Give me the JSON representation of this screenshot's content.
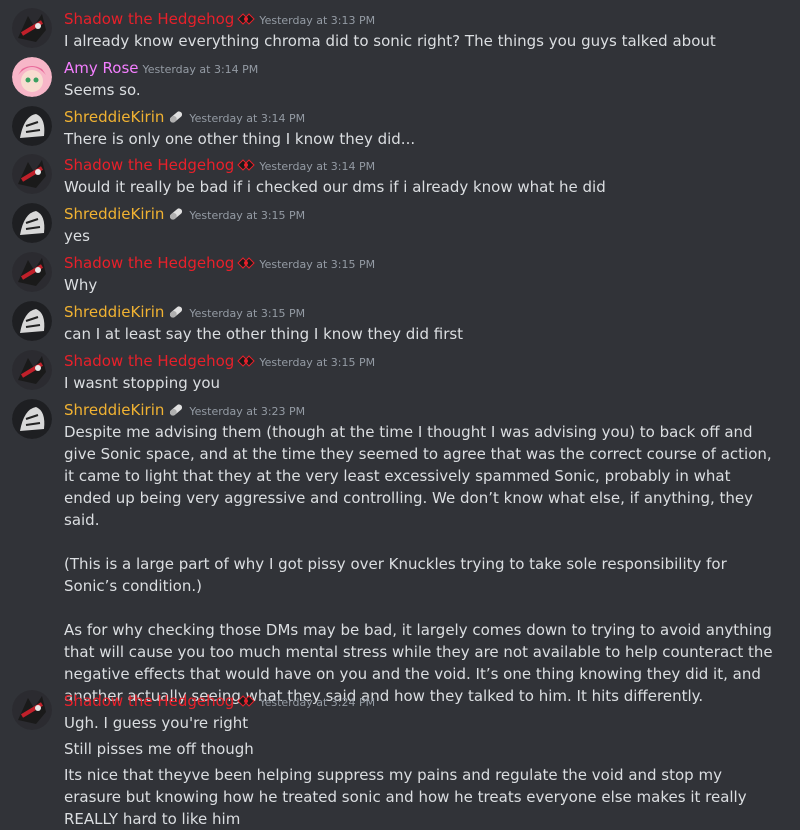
{
  "users": {
    "shadow": {
      "name": "Shadow the Hedgehog",
      "color": "#e8202a",
      "badge_icon": "shadow-emblem-icon"
    },
    "amy": {
      "name": "Amy Rose",
      "color": "#f47fff"
    },
    "kirin": {
      "name": "ShreddieKirin",
      "color": "#f0b232",
      "badge_icon": "pill-icon"
    }
  },
  "messages": [
    {
      "author": "Shadow the Hedgehog",
      "timestamp": "Yesterday at 3:13 PM",
      "text": "I already know everything chroma did to sonic right? The things you guys talked about"
    },
    {
      "author": "Amy Rose",
      "timestamp": "Yesterday at 3:14 PM",
      "text": "Seems so."
    },
    {
      "author": "ShreddieKirin",
      "timestamp": "Yesterday at 3:14 PM",
      "text": "There is only one other thing I know they did..."
    },
    {
      "author": "Shadow the Hedgehog",
      "timestamp": "Yesterday at 3:14 PM",
      "text": "Would it really be bad if i checked our dms if i already know what he did"
    },
    {
      "author": "ShreddieKirin",
      "timestamp": "Yesterday at 3:15 PM",
      "text": "yes"
    },
    {
      "author": "Shadow the Hedgehog",
      "timestamp": "Yesterday at 3:15 PM",
      "text": "Why"
    },
    {
      "author": "ShreddieKirin",
      "timestamp": "Yesterday at 3:15 PM",
      "text": "can I at least say the other thing I know they did first"
    },
    {
      "author": "Shadow the Hedgehog",
      "timestamp": "Yesterday at 3:15 PM",
      "text": "I wasnt stopping you"
    },
    {
      "author": "ShreddieKirin",
      "timestamp": "Yesterday at 3:23 PM",
      "p1": "Despite me advising them (though at the time I thought I was advising you) to back off and give Sonic space, and at the time they seemed to agree that was the correct course of action, it came to light that they at the very least excessively spammed Sonic, probably in what ended up being very aggressive and controlling. We don’t know what else, if anything, they said.",
      "p2": "(This is a large part of why I got pissy over Knuckles trying to take sole responsibility for Sonic’s condition.)",
      "p3": "As for why checking those DMs may be bad, it largely comes down to trying to avoid anything that will cause you too much mental stress while they are not available to help counteract the negative effects that would have on you and the void. It’s one thing knowing they did it, and another actually seeing what they said and how they talked to him. It hits differently."
    },
    {
      "author": "Shadow the Hedgehog",
      "timestamp": "Yesterday at 3:24 PM",
      "l1": "Ugh. I guess you're right",
      "l2": "Still pisses me off though",
      "l3": "Its nice that theyve been helping suppress my pains and regulate the void and stop my erasure but knowing how he treated sonic and how he treats everyone else makes it really REALLY hard to like him"
    }
  ]
}
